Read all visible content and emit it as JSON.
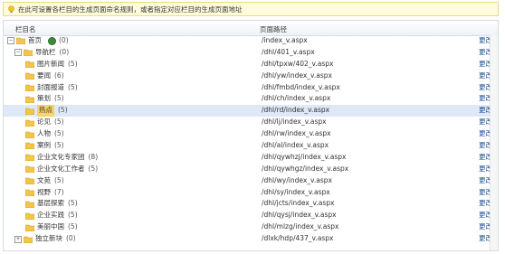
{
  "tip": {
    "text": "在此可设置各栏目的生成页面命名规则，或者指定对应栏目的生成页面地址",
    "icon": "lightbulb-icon"
  },
  "columns": {
    "name": "栏目名",
    "path": "页面路径"
  },
  "edit_label": "更改",
  "rows": [
    {
      "level": 0,
      "name": "首页",
      "count": "(0)",
      "path": "/index_v.aspx",
      "expander": "−",
      "globe": true
    },
    {
      "level": 1,
      "name": "导航栏",
      "count": "(0)",
      "path": "/dhl/401_v.aspx",
      "expander": "−"
    },
    {
      "level": 2,
      "name": "图片新闻",
      "count": "(5)",
      "path": "/dhl/tpxw/402_v.aspx"
    },
    {
      "level": 2,
      "name": "要闻",
      "count": "(6)",
      "path": "/dhl/yw/index_v.aspx"
    },
    {
      "level": 2,
      "name": "封面报道",
      "count": "(5)",
      "path": "/dhl/fmbd/index_v.aspx"
    },
    {
      "level": 2,
      "name": "策划",
      "count": "(5)",
      "path": "/dhl/ch/index_v.aspx"
    },
    {
      "level": 2,
      "name": "热点",
      "count": "(5)",
      "path": "/dhl/rd/index_v.aspx",
      "selected": true
    },
    {
      "level": 2,
      "name": "论见",
      "count": "(5)",
      "path": "/dhl/lj/index_v.aspx"
    },
    {
      "level": 2,
      "name": "人物",
      "count": "(5)",
      "path": "/dhl/rw/index_v.aspx"
    },
    {
      "level": 2,
      "name": "案例",
      "count": "(5)",
      "path": "/dhl/al/index_v.aspx"
    },
    {
      "level": 2,
      "name": "企业文化专家团",
      "count": "(8)",
      "path": "/dhl/qywhzj/index_v.aspx"
    },
    {
      "level": 2,
      "name": "企业文化工作者",
      "count": "(5)",
      "path": "/dhl/qywhgz/index_v.aspx"
    },
    {
      "level": 2,
      "name": "文苑",
      "count": "(5)",
      "path": "/dhl/wy/index_v.aspx"
    },
    {
      "level": 2,
      "name": "视野",
      "count": "(7)",
      "path": "/dhl/sy/index_v.aspx"
    },
    {
      "level": 2,
      "name": "基层探索",
      "count": "(5)",
      "path": "/dhl/jcts/index_v.aspx"
    },
    {
      "level": 2,
      "name": "企业实践",
      "count": "(5)",
      "path": "/dhl/qysj/index_v.aspx"
    },
    {
      "level": 2,
      "name": "美丽中国",
      "count": "(5)",
      "path": "/dhl/mlzg/index_v.aspx"
    },
    {
      "level": 1,
      "name": "独立新块",
      "count": "(0)",
      "path": "/dlxk/hdp/437_v.aspx",
      "expander": "+"
    }
  ]
}
